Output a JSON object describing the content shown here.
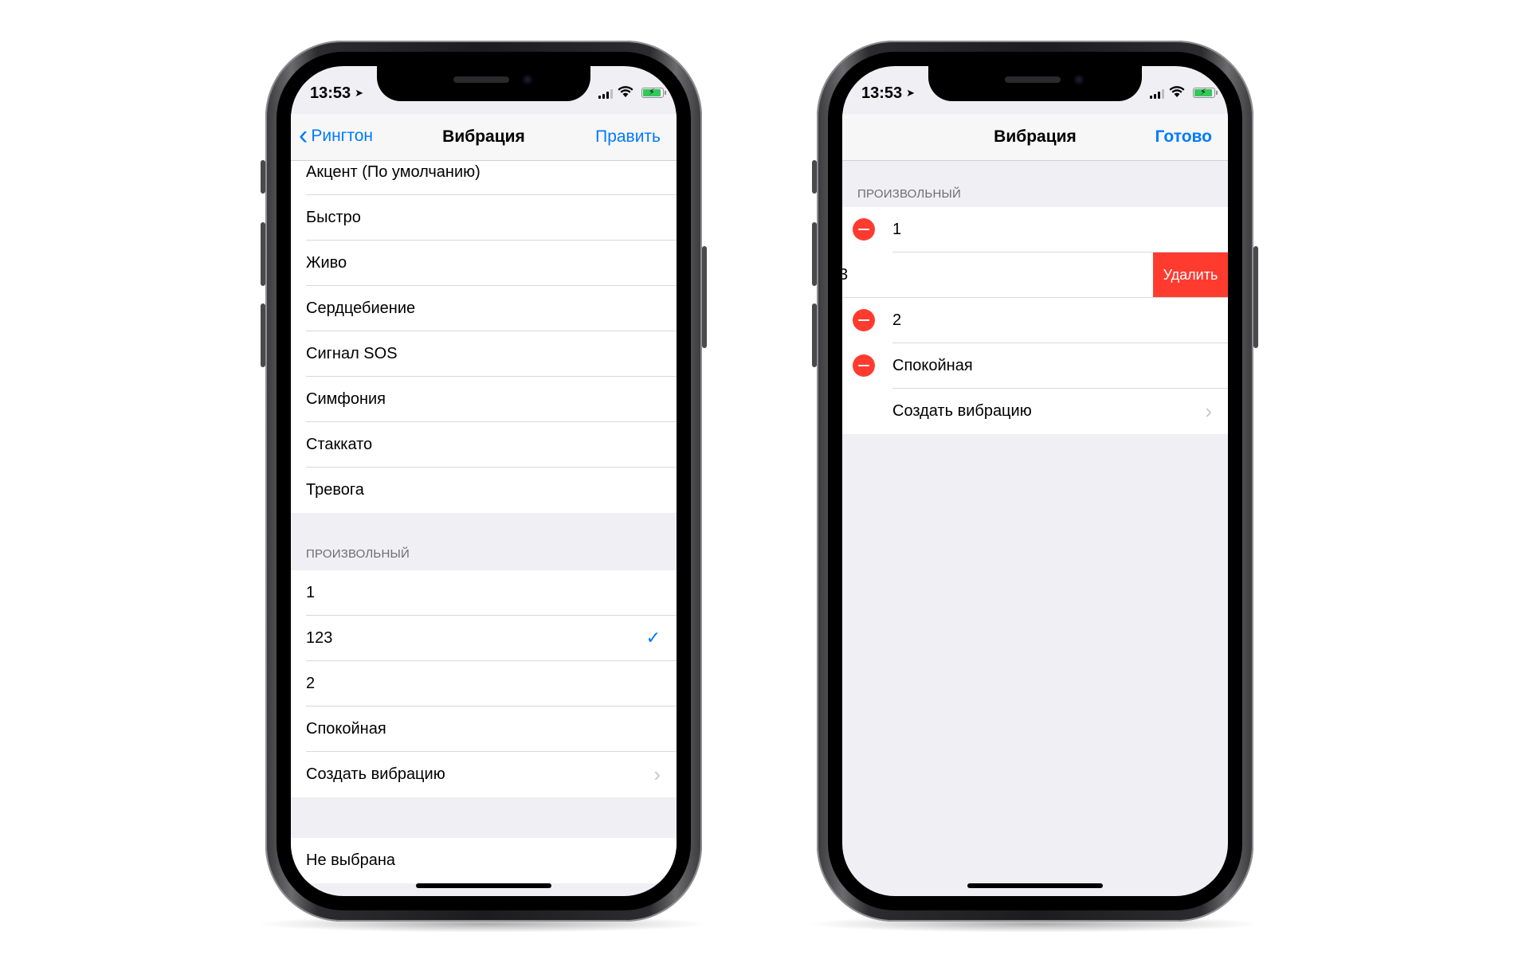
{
  "status": {
    "time": "13:53"
  },
  "left": {
    "nav": {
      "back_label": "Рингтон",
      "title": "Вибрация",
      "action_label": "Править"
    },
    "standard_items": [
      "Акцент (По умолчанию)",
      "Быстро",
      "Живо",
      "Сердцебиение",
      "Сигнал SOS",
      "Симфония",
      "Стаккато",
      "Тревога"
    ],
    "custom_header": "ПРОИЗВОЛЬНЫЙ",
    "custom_items": [
      "1",
      "123",
      "2",
      "Спокойная"
    ],
    "selected_item": "123",
    "create_label": "Создать вибрацию",
    "none_label": "Не выбрана"
  },
  "right": {
    "nav": {
      "title": "Вибрация",
      "action_label": "Готово"
    },
    "custom_header": "ПРОИЗВОЛЬНЫЙ",
    "item_1": "1",
    "swiped_peek": "3",
    "delete_label": "Удалить",
    "item_2": "2",
    "item_3": "Спокойная",
    "create_label": "Создать вибрацию"
  },
  "colors": {
    "accent": "#007aff",
    "destructive": "#ff3b30",
    "battery": "#34c759"
  }
}
